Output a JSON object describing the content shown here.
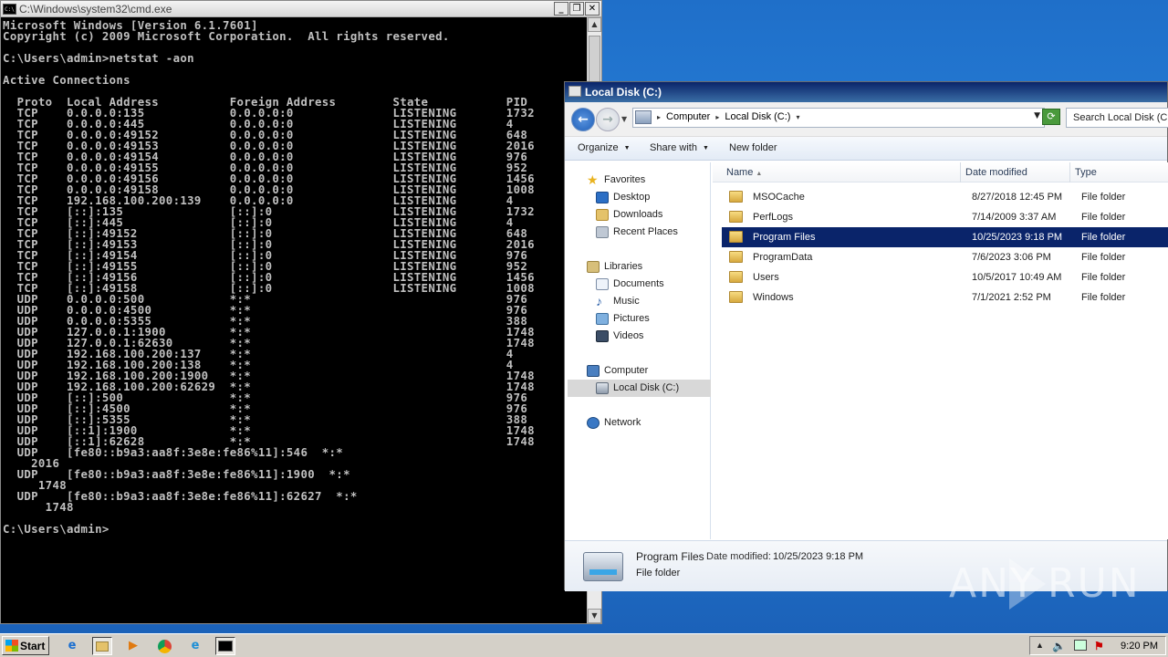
{
  "cmd": {
    "title": "C:\\Windows\\system32\\cmd.exe",
    "lines": [
      "Microsoft Windows [Version 6.1.7601]",
      "Copyright (c) 2009 Microsoft Corporation.  All rights reserved.",
      "",
      "C:\\Users\\admin>netstat -aon",
      "",
      "Active Connections",
      "",
      "  Proto  Local Address          Foreign Address        State           PID",
      "  TCP    0.0.0.0:135            0.0.0.0:0              LISTENING       1732",
      "  TCP    0.0.0.0:445            0.0.0.0:0              LISTENING       4",
      "  TCP    0.0.0.0:49152          0.0.0.0:0              LISTENING       648",
      "  TCP    0.0.0.0:49153          0.0.0.0:0              LISTENING       2016",
      "  TCP    0.0.0.0:49154          0.0.0.0:0              LISTENING       976",
      "  TCP    0.0.0.0:49155          0.0.0.0:0              LISTENING       952",
      "  TCP    0.0.0.0:49156          0.0.0.0:0              LISTENING       1456",
      "  TCP    0.0.0.0:49158          0.0.0.0:0              LISTENING       1008",
      "  TCP    192.168.100.200:139    0.0.0.0:0              LISTENING       4",
      "  TCP    [::]:135               [::]:0                 LISTENING       1732",
      "  TCP    [::]:445               [::]:0                 LISTENING       4",
      "  TCP    [::]:49152             [::]:0                 LISTENING       648",
      "  TCP    [::]:49153             [::]:0                 LISTENING       2016",
      "  TCP    [::]:49154             [::]:0                 LISTENING       976",
      "  TCP    [::]:49155             [::]:0                 LISTENING       952",
      "  TCP    [::]:49156             [::]:0                 LISTENING       1456",
      "  TCP    [::]:49158             [::]:0                 LISTENING       1008",
      "  UDP    0.0.0.0:500            *:*                                    976",
      "  UDP    0.0.0.0:4500           *:*                                    976",
      "  UDP    0.0.0.0:5355           *:*                                    388",
      "  UDP    127.0.0.1:1900         *:*                                    1748",
      "  UDP    127.0.0.1:62630        *:*                                    1748",
      "  UDP    192.168.100.200:137    *:*                                    4",
      "  UDP    192.168.100.200:138    *:*                                    4",
      "  UDP    192.168.100.200:1900   *:*                                    1748",
      "  UDP    192.168.100.200:62629  *:*                                    1748",
      "  UDP    [::]:500               *:*                                    976",
      "  UDP    [::]:4500              *:*                                    976",
      "  UDP    [::]:5355              *:*                                    388",
      "  UDP    [::1]:1900             *:*                                    1748",
      "  UDP    [::1]:62628            *:*                                    1748",
      "  UDP    [fe80::b9a3:aa8f:3e8e:fe86%11]:546  *:*",
      "    2016",
      "  UDP    [fe80::b9a3:aa8f:3e8e:fe86%11]:1900  *:*",
      "     1748",
      "  UDP    [fe80::b9a3:aa8f:3e8e:fe86%11]:62627  *:*",
      "      1748",
      "",
      "C:\\Users\\admin>"
    ]
  },
  "explorer": {
    "title": "Local Disk (C:)",
    "breadcrumbs": [
      "Computer",
      "Local Disk (C:)"
    ],
    "search_placeholder": "Search Local Disk (C:)",
    "toolbar": {
      "organize": "Organize",
      "share_with": "Share with",
      "new_folder": "New folder"
    },
    "nav": {
      "favorites": "Favorites",
      "desktop": "Desktop",
      "downloads": "Downloads",
      "recent": "Recent Places",
      "libraries": "Libraries",
      "documents": "Documents",
      "music": "Music",
      "pictures": "Pictures",
      "videos": "Videos",
      "computer": "Computer",
      "local_disk": "Local Disk (C:)",
      "network": "Network"
    },
    "columns": {
      "name": "Name",
      "date": "Date modified",
      "type": "Type"
    },
    "files": [
      {
        "name": "MSOCache",
        "date": "8/27/2018 12:45 PM",
        "type": "File folder"
      },
      {
        "name": "PerfLogs",
        "date": "7/14/2009 3:37 AM",
        "type": "File folder"
      },
      {
        "name": "Program Files",
        "date": "10/25/2023 9:18 PM",
        "type": "File folder"
      },
      {
        "name": "ProgramData",
        "date": "7/6/2023 3:06 PM",
        "type": "File folder"
      },
      {
        "name": "Users",
        "date": "10/5/2017 10:49 AM",
        "type": "File folder"
      },
      {
        "name": "Windows",
        "date": "7/1/2021 2:52 PM",
        "type": "File folder"
      }
    ],
    "selected_file": "Program Files",
    "details": {
      "name": "Program Files",
      "modified_label": "Date modified:",
      "modified": "10/25/2023 9:18 PM",
      "type": "File folder"
    }
  },
  "watermark": {
    "left": "ANY",
    "right": "RUN"
  },
  "taskbar": {
    "start_label": "Start",
    "clock": "9:20 PM"
  },
  "colors": {
    "desktop": "#2a86de",
    "console_bg": "#000000",
    "console_fg": "#c0c0c0",
    "selection": "#0a246a"
  }
}
